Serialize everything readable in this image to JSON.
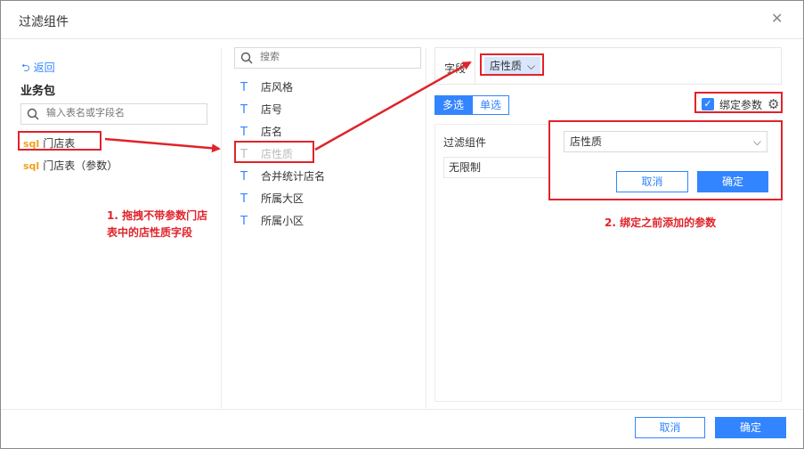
{
  "dialog": {
    "title": "过滤组件"
  },
  "left": {
    "back_label": "返回",
    "package_title": "业务包",
    "search_placeholder": "输入表名或字段名",
    "tables": [
      {
        "icon": "sql",
        "name": "门店表"
      },
      {
        "icon": "sql",
        "name": "门店表（参数）"
      }
    ]
  },
  "middle": {
    "search_placeholder": "搜索",
    "field_type_glyph": "T",
    "fields": [
      "店风格",
      "店号",
      "店名",
      "店性质",
      "合并统计店名",
      "所属大区",
      "所属小区"
    ]
  },
  "right": {
    "field_label": "字段",
    "field_chip": "店性质",
    "tabs": [
      "多选",
      "单选"
    ],
    "bind_param_label": "绑定参数",
    "filter_component_label": "过滤组件",
    "filter_value": "无限制",
    "param_select_value": "店性质",
    "popup_cancel": "取消",
    "popup_confirm": "确定"
  },
  "footer": {
    "cancel": "取消",
    "confirm": "确定"
  },
  "annotations": {
    "note1_line1": "1. 拖拽不带参数门店",
    "note1_line2": "表中的店性质字段",
    "note2": "2. 绑定之前添加的参数"
  },
  "colors": {
    "accent": "#3285ff",
    "annotation": "#e0232b",
    "sql_icon": "#f0a020"
  },
  "icons": [
    "close-icon",
    "back-arrow-icon",
    "search-icon",
    "sql-table-icon",
    "text-field-icon",
    "chevron-down-icon",
    "checkbox-checked-icon",
    "gear-icon"
  ]
}
